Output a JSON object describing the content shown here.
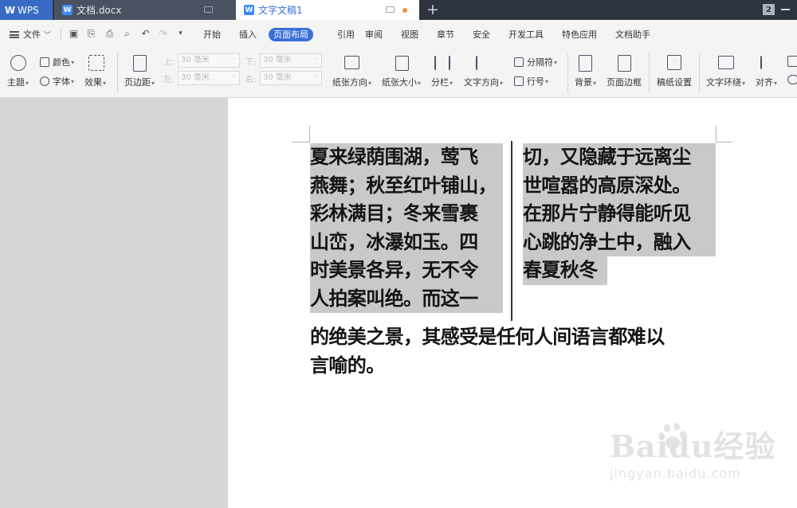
{
  "tabs": {
    "wps_label": "WPS",
    "doc_label": "文档.docx",
    "active_label": "文字文稿1",
    "badge": "2"
  },
  "menu": {
    "file_label": "文件",
    "tabs": [
      "开始",
      "插入",
      "页面布局",
      "引用",
      "审阅",
      "视图",
      "章节",
      "安全",
      "开发工具",
      "特色应用",
      "文档助手"
    ],
    "active_tab": "页面布局"
  },
  "ribbon": {
    "theme": "主题",
    "color": "颜色",
    "font": "字体",
    "effect": "效果",
    "margins": "页边距",
    "margin_top_label": "上:",
    "margin_bottom_label": "下:",
    "margin_left_label": "左:",
    "margin_right_label": "右:",
    "margin_value": "30 毫米",
    "orientation": "纸张方向",
    "size": "纸张大小",
    "columns": "分栏",
    "text_direction": "文字方向",
    "breaks": "分隔符",
    "line_numbers": "行号",
    "background": "背景",
    "page_border": "页面边框",
    "manuscript": "稿纸设置",
    "text_wrap": "文字环绕",
    "align": "对齐"
  },
  "document": {
    "left_column": [
      "夏来绿荫围湖，莺飞",
      "燕舞；秋至红叶铺山，",
      "彩林满目；冬来雪裹",
      "山峦，冰瀑如玉。四",
      "时美景各异，无不令",
      "人拍案叫绝。而这一"
    ],
    "right_column": [
      "切，又隐藏于远离尘",
      "世喧嚣的高原深处。",
      "在那片宁静得能听见",
      "心跳的净土中，融入",
      "春夏秋冬"
    ],
    "full_width": [
      "的绝美之景，其感受是任何人间语言都难以",
      "言喻的。"
    ]
  },
  "watermark": {
    "logo": "Baidu经验",
    "url": "jingyan.baidu.com"
  }
}
